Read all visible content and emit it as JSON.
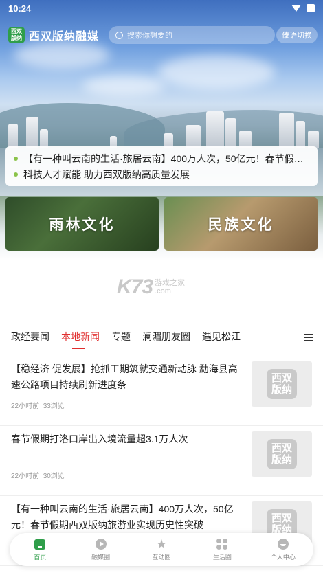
{
  "status_bar": {
    "time": "10:24"
  },
  "header": {
    "logo_text": "西双 版纳",
    "app_name": "西双版纳融媒",
    "search_placeholder": "搜索你想要的",
    "lang_switch_label": "傣语切换"
  },
  "headlines": [
    "【有一种叫云南的生活·旅居云南】400万人次，50亿元！春节假期...",
    "科技人才赋能 助力西双版纳高质量发展"
  ],
  "culture_cards": [
    {
      "label": "雨林文化"
    },
    {
      "label": "民族文化"
    }
  ],
  "watermark": {
    "main": "K73",
    "sub_top": "游戏之家",
    "sub_bottom": ".com"
  },
  "tabs": [
    {
      "label": "政经要闻",
      "active": false
    },
    {
      "label": "本地新闻",
      "active": true
    },
    {
      "label": "专题",
      "active": false
    },
    {
      "label": "澜湄朋友圈",
      "active": false
    },
    {
      "label": "遇见松江",
      "active": false
    }
  ],
  "news": [
    {
      "title": "【稳经济 促发展】抢抓工期筑就交通新动脉 勐海县高速公路项目持续刷新进度条",
      "time": "22小时前",
      "views": "33浏览",
      "thumb_text": "西双 版纳"
    },
    {
      "title": "春节假期打洛口岸出入境流量超3.1万人次",
      "time": "22小时前",
      "views": "30浏览",
      "thumb_text": "西双 版纳"
    },
    {
      "title": "【有一种叫云南的生活·旅居云南】400万人次，50亿元！春节假期西双版纳旅游业实现历史性突破",
      "time": "",
      "views": "",
      "thumb_text": "西双 版纳"
    }
  ],
  "bottom_nav": [
    {
      "label": "首页",
      "icon": "home-icon",
      "active": true
    },
    {
      "label": "融媒圈",
      "icon": "play-icon",
      "active": false
    },
    {
      "label": "互动圈",
      "icon": "star-icon",
      "active": false
    },
    {
      "label": "生活圈",
      "icon": "grid-icon",
      "active": false
    },
    {
      "label": "个人中心",
      "icon": "user-icon",
      "active": false
    }
  ],
  "colors": {
    "accent_red": "#e02e2e",
    "brand_green": "#2f9e4a"
  }
}
